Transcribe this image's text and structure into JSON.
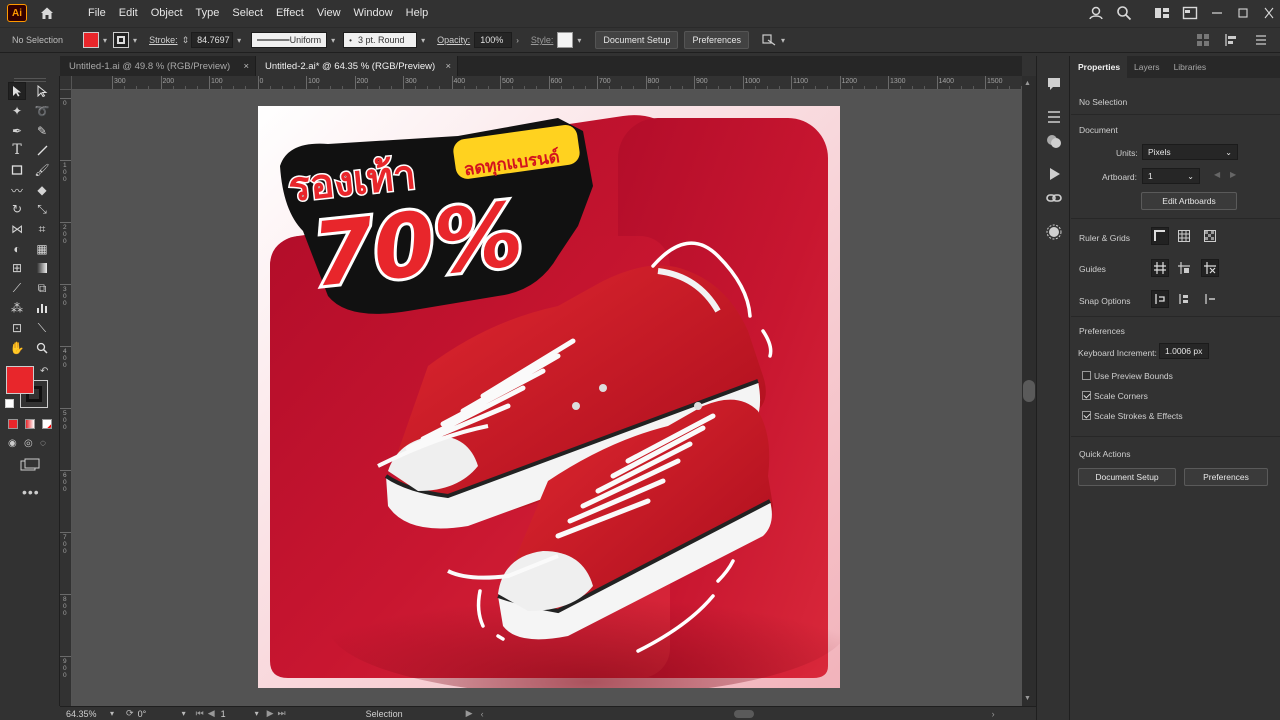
{
  "menubar": {
    "logo": "Ai",
    "items": [
      "File",
      "Edit",
      "Object",
      "Type",
      "Select",
      "Effect",
      "View",
      "Window",
      "Help"
    ]
  },
  "controlbar": {
    "selection": "No Selection",
    "stroke_label": "Stroke:",
    "stroke_value": "84.7697",
    "stroke_profile": "Uniform",
    "brush": "3 pt. Round",
    "opacity_label": "Opacity:",
    "opacity_value": "100%",
    "style_label": "Style:",
    "document_setup": "Document Setup",
    "preferences": "Preferences",
    "fill_color": "#e8262b"
  },
  "tabs": [
    {
      "label": "Untitled-1.ai @ 49.8 % (RGB/Preview)",
      "active": false
    },
    {
      "label": "Untitled-2.ai* @ 64.35 % (RGB/Preview)",
      "active": true
    }
  ],
  "ruler": {
    "top": [
      "300",
      "200",
      "100",
      "0",
      "100",
      "200",
      "300",
      "400",
      "500",
      "600",
      "700",
      "800",
      "900",
      "1000",
      "1100",
      "1200",
      "1300",
      "1400",
      "1500"
    ],
    "left": [
      "0",
      "100",
      "200",
      "300",
      "400",
      "500",
      "600",
      "700",
      "800",
      "900"
    ]
  },
  "statusbar": {
    "zoom": "64.35%",
    "rotation": "0°",
    "artboard": "1",
    "mode": "Selection"
  },
  "properties": {
    "tabs": [
      "Properties",
      "Layers",
      "Libraries"
    ],
    "no_selection": "No Selection",
    "document_title": "Document",
    "units_label": "Units:",
    "units_value": "Pixels",
    "artboard_label": "Artboard:",
    "artboard_value": "1",
    "edit_artboards": "Edit Artboards",
    "ruler_grids": "Ruler & Grids",
    "guides": "Guides",
    "snap_options": "Snap Options",
    "preferences_title": "Preferences",
    "keyboard_increment_label": "Keyboard Increment:",
    "keyboard_increment_value": "1.0006 px",
    "use_preview_bounds": "Use Preview Bounds",
    "scale_corners": "Scale Corners",
    "scale_strokes": "Scale Strokes & Effects",
    "quick_actions": "Quick Actions",
    "document_setup": "Document Setup",
    "preferences": "Preferences"
  },
  "artwork": {
    "headline_thai": "รองเท้า",
    "badge_thai": "ลดทุกแบรนด์",
    "discount": "70%",
    "bg_color": "#c8102e"
  }
}
